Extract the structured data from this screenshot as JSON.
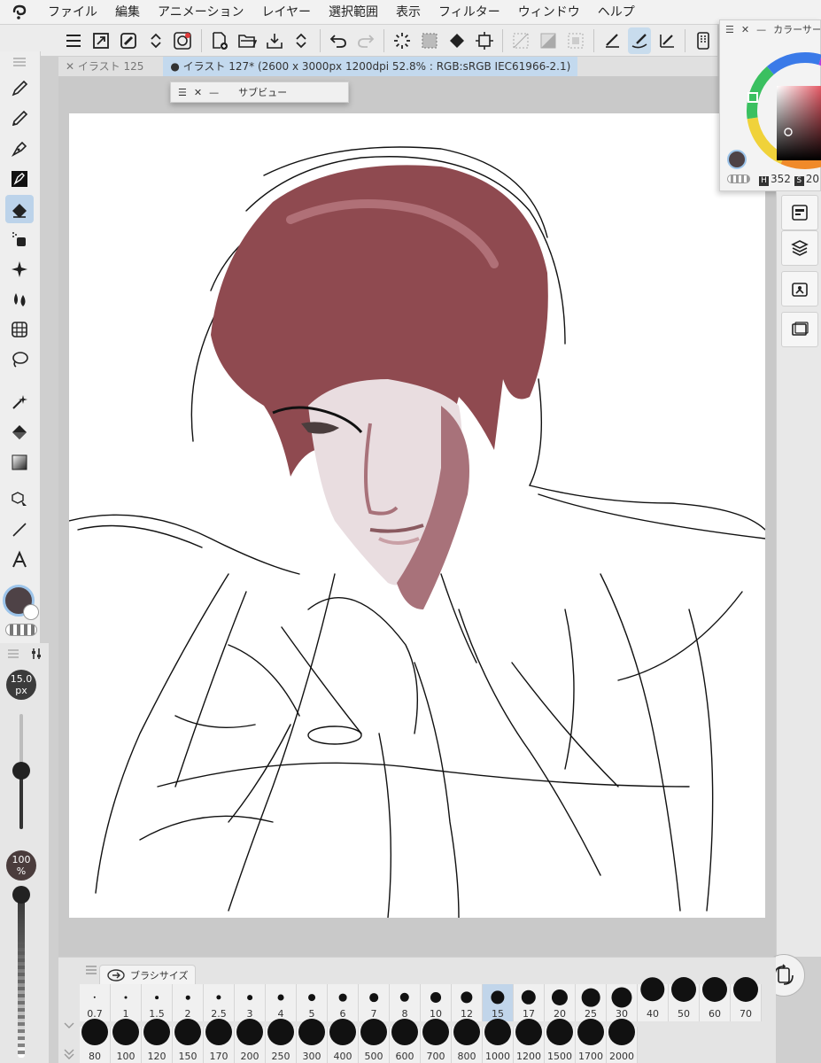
{
  "menu": [
    "ファイル",
    "編集",
    "アニメーション",
    "レイヤー",
    "選択範囲",
    "表示",
    "フィルター",
    "ウィンドウ",
    "ヘルプ"
  ],
  "tabs": {
    "inactive": "イラスト 125",
    "active": "イラスト 127* (2600 x 3000px 1200dpi 52.8% : RGB:sRGB IEC61966-2.1)"
  },
  "subview": {
    "title": "サブビュー"
  },
  "color_panel": {
    "title": "カラーサークル",
    "h_value": "352",
    "s_value": "20",
    "h_key": "H",
    "s_key": "S"
  },
  "brush": {
    "size_value": "15.0",
    "size_unit": "px",
    "opacity_value": "100",
    "opacity_unit": "%"
  },
  "colors": {
    "main": "#4e4246",
    "accent": "#c3d9ee",
    "hair": "#8f4a50"
  },
  "brush_size_panel": {
    "title": "ブラシサイズ",
    "selected": "15",
    "row1": [
      "0.7",
      "1",
      "1.5",
      "2",
      "2.5",
      "3",
      "4",
      "5",
      "6",
      "7",
      "8",
      "10",
      "12",
      "15",
      "17",
      "20",
      "25",
      "30",
      "40",
      "50",
      "60",
      "70"
    ],
    "row2": [
      "80",
      "100",
      "120",
      "150",
      "170",
      "200",
      "250",
      "300",
      "400",
      "500",
      "600",
      "700",
      "800",
      "1000",
      "1200",
      "1500",
      "1700",
      "2000"
    ]
  }
}
